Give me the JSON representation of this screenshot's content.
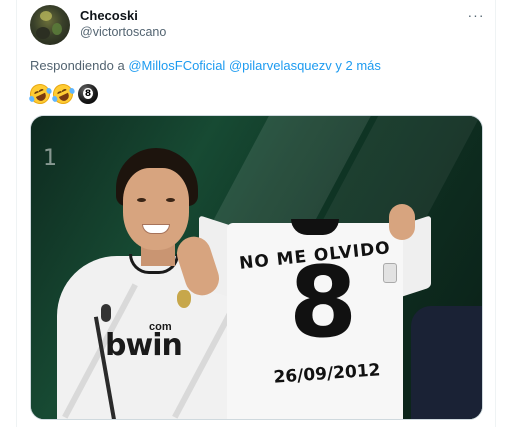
{
  "tweet": {
    "author": {
      "display_name": "Checoski",
      "handle": "@victortoscano",
      "avatar_icon": "avatar-image"
    },
    "more_icon": "more-options-icon",
    "reply_to": {
      "prefix": "Respondiendo a",
      "mentions": [
        "@MillosFCoficial",
        "@pilarvelasquezv"
      ],
      "suffix": "y 2 más"
    },
    "emojis": [
      "rolling-on-floor-laughing-emoji",
      "rolling-on-floor-laughing-emoji",
      "pool-8-ball-emoji"
    ],
    "media": {
      "kind": "photo",
      "shirt_caption": "NO ME OLVIDO",
      "shirt_number": "8",
      "shirt_date": "26/09/2012",
      "sponsor_top": "com",
      "sponsor_main": "bwin",
      "background_number": "1"
    }
  },
  "colors": {
    "link": "#1d9bf0",
    "secondary_text": "#536471",
    "primary_text": "#0f1419",
    "border": "#cfd9de"
  }
}
